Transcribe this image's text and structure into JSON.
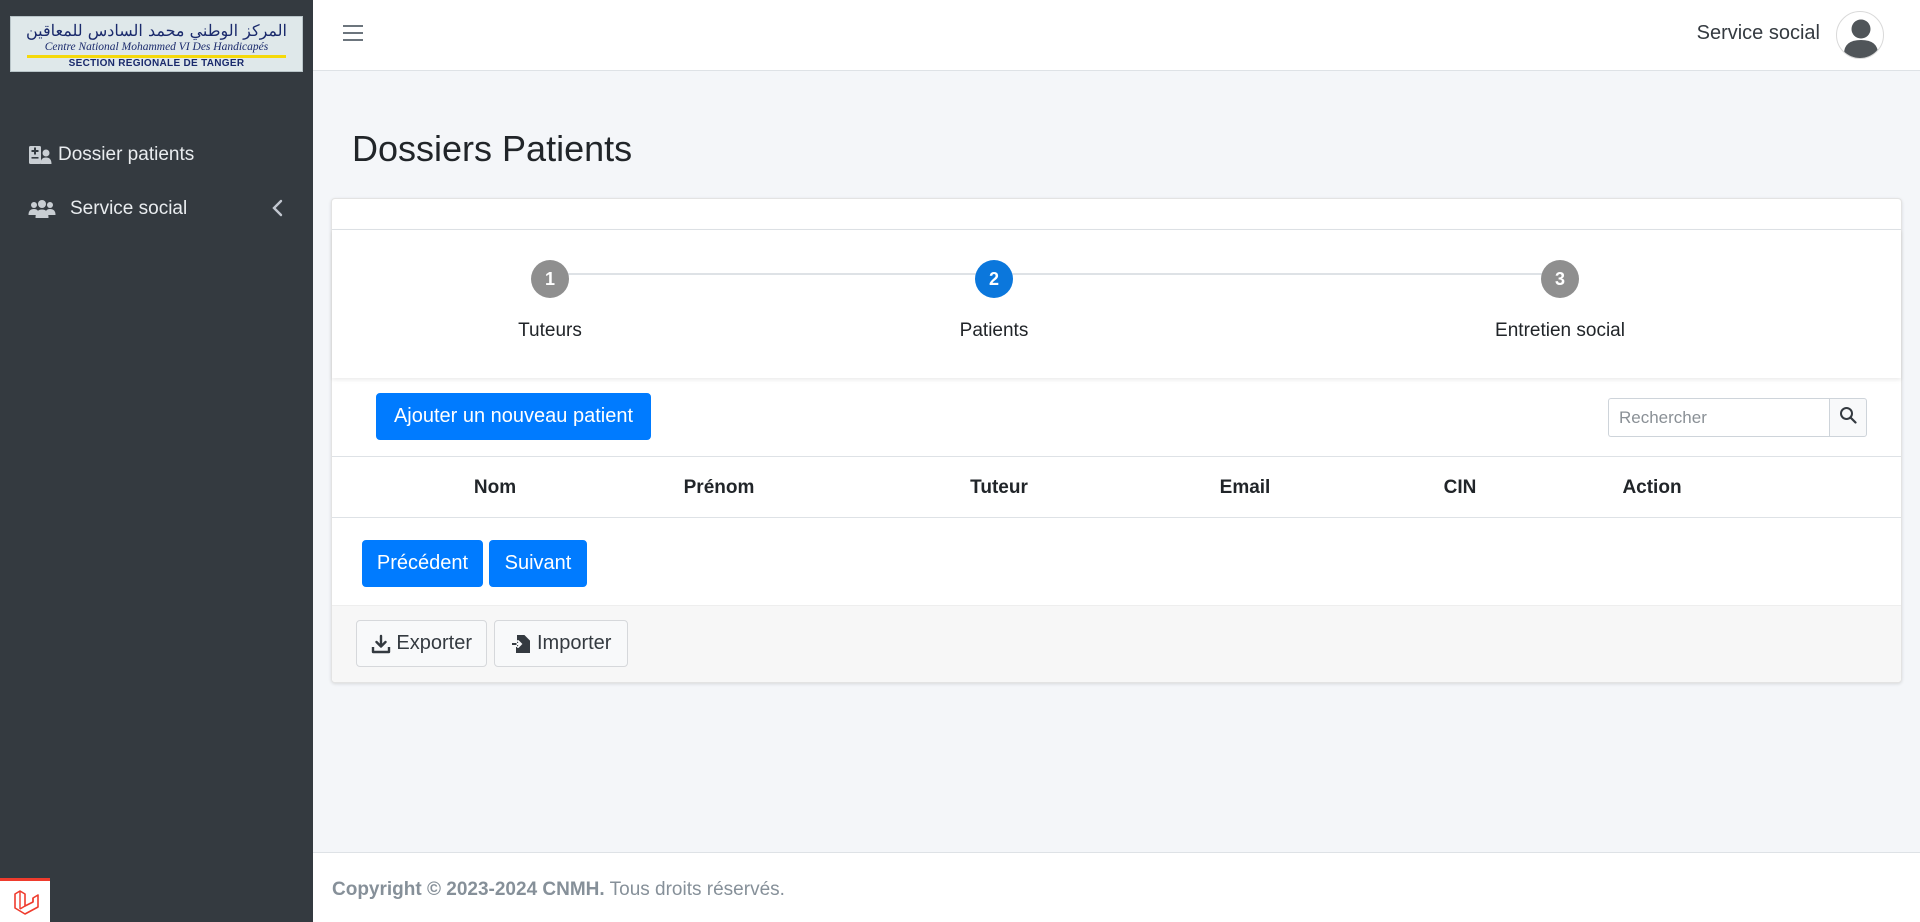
{
  "brand": {
    "arabic_text": "المركز الوطني محمد السادس للمعاقين",
    "french_text": "Centre National Mohammed VI Des Handicapés",
    "section_text": "SECTION REGIONALE DE TANGER"
  },
  "sidebar": {
    "items": [
      {
        "label": "Dossier patients",
        "icon": "patient-file-icon"
      },
      {
        "label": "Service social",
        "icon": "users-icon",
        "has_chevron": true
      }
    ]
  },
  "header": {
    "user_name": "Service social",
    "menu_icon": "hamburger-icon",
    "avatar_icon": "user-avatar-icon"
  },
  "page": {
    "title": "Dossiers Patients"
  },
  "stepper": {
    "active_step": 2,
    "steps": [
      {
        "number": "1",
        "label": "Tuteurs"
      },
      {
        "number": "2",
        "label": "Patients"
      },
      {
        "number": "3",
        "label": "Entretien social"
      }
    ]
  },
  "toolbar": {
    "add_label": "Ajouter un nouveau patient",
    "search_placeholder": "Rechercher"
  },
  "table": {
    "columns": [
      "Nom",
      "Prénom",
      "Tuteur",
      "Email",
      "CIN",
      "Action"
    ],
    "rows": []
  },
  "pagination": {
    "prev_label": "Précédent",
    "next_label": "Suivant"
  },
  "actions": {
    "export_label": "Exporter",
    "import_label": "Importer"
  },
  "footer": {
    "copyright": "Copyright © 2023-2024 CNMH.",
    "rights": "Tous droits réservés."
  },
  "colors": {
    "sidebar_bg": "#343a40",
    "primary": "#007bff",
    "step_active": "#0b77dc",
    "step_inactive": "#8f8f8f",
    "page_bg": "#f4f6f9",
    "laravel_red": "#ef3b2d"
  }
}
